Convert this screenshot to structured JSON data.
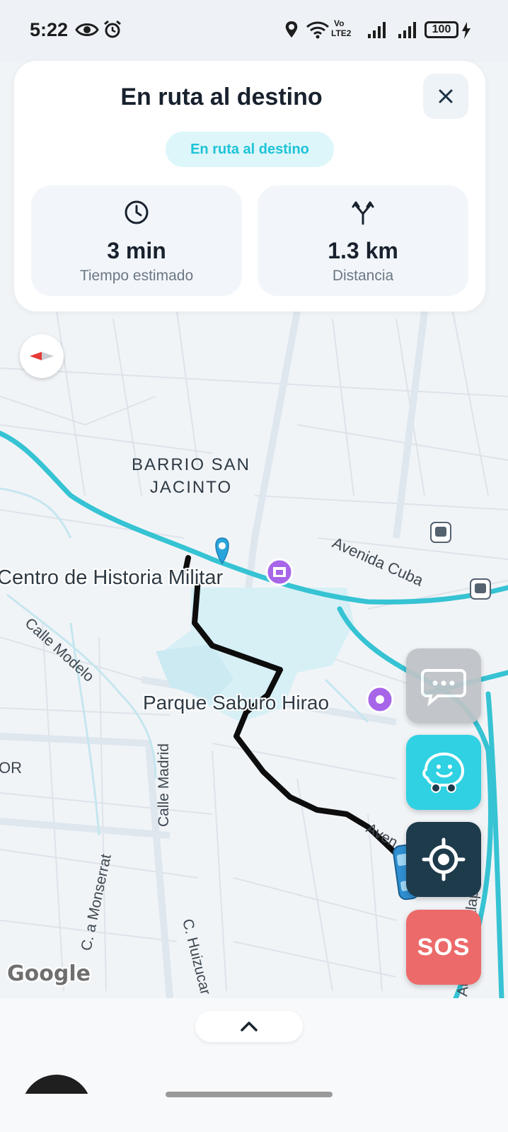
{
  "status_bar": {
    "time": "5:22",
    "network_label_top": "Vo",
    "network_label_bottom": "LTE2",
    "battery": "100"
  },
  "trip_card": {
    "title": "En ruta al destino",
    "status_pill": "En ruta al destino",
    "eta": {
      "value": "3 min",
      "label": "Tiempo estimado",
      "icon": "clock-icon"
    },
    "distance": {
      "value": "1.3 km",
      "label": "Distancia",
      "icon": "route-split-icon"
    }
  },
  "map": {
    "labels": {
      "neighborhood_line1": "BARRIO SAN",
      "neighborhood_line2": "JACINTO",
      "museum": "Centro de Historia Militar",
      "park": "Parque Saburo Hirao",
      "avenida_cuba": "Avenida Cuba",
      "calle_modelo": "Calle Modelo",
      "calle_madrid": "Calle Madrid",
      "c_monserrat": "C. a Monserrat",
      "c_huizucar": "C. Huizucar",
      "autop_comalapa": "Autop. Comalapa",
      "avenida_partial": "Aven",
      "left_edge_partial": "OR"
    },
    "attribution": "Google",
    "colors": {
      "route": "#111111",
      "main_road": "#36c3d3",
      "water": "#d2eff5"
    }
  },
  "actions": {
    "sos_label": "SOS",
    "chat_icon": "chat-bubble-icon",
    "waze_icon": "waze-icon",
    "locate_icon": "crosshair-icon"
  },
  "bottom_sheet": {
    "expand_icon": "chevron-up-icon"
  }
}
